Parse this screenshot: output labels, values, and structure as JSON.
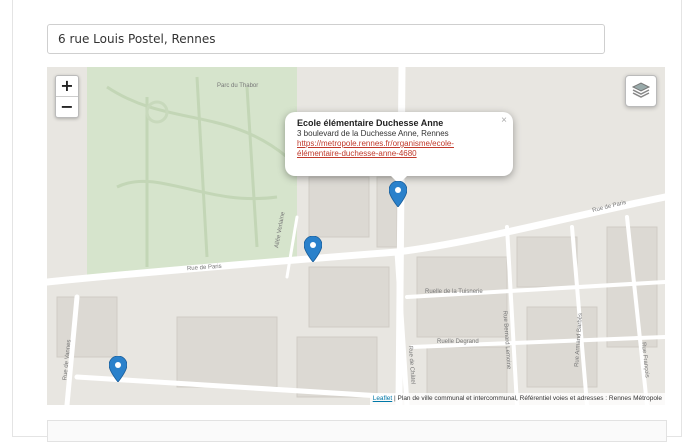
{
  "search": {
    "value": "6 rue Louis Postel, Rennes"
  },
  "map": {
    "zoom_in": "+",
    "zoom_out": "−",
    "layers_icon": "layers-icon",
    "popup": {
      "title": "Ecole élémentaire Duchesse Anne",
      "address": "3 boulevard de la Duchesse Anne, Rennes",
      "link_line1": "https://metropole.rennes.fr/organisme/ecole-",
      "link_line2": "élémentaire-duchesse-anne-4680",
      "close": "×"
    },
    "labels": {
      "parc": "Parc du Thabor",
      "rue_de_paris_left": "Rue de Paris",
      "rue_de_paris_right": "Rue de Paris",
      "rue_tuisnerie": "Ruelle de la Tuisnerie",
      "ruelle_degrand": "Ruelle Degrand",
      "rue_armand_barbes": "Rue Armand Barbès",
      "rue_chatel": "Rue de Châtel",
      "rue_bernard_lemoine": "Rue Bernard Lemoine",
      "allee_verlaine": "Allée Verlaine",
      "rue_de_vanves": "Rue de Vannes",
      "rue_francois": "Rue François"
    },
    "attribution_link": "Leaflet",
    "attribution_text": " | Plan de ville communal et intercommunal, Référentiel voies et adresses : Rennes Métropole",
    "marker_color": "#2a81cb"
  }
}
